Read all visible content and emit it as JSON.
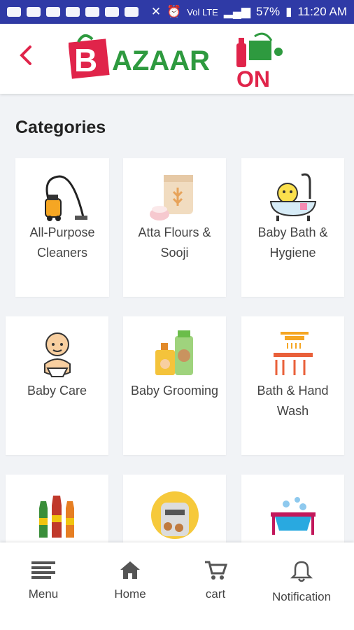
{
  "status_bar": {
    "battery": "57%",
    "time": "11:20 AM",
    "network_small": "Vol LTE"
  },
  "header": {
    "logo_text_main": "AZAAR",
    "logo_text_b": "B",
    "logo_text_on": "ON"
  },
  "page": {
    "section_title": "Categories"
  },
  "categories": [
    {
      "label_line1": "All-Purpose",
      "label_line2": "Cleaners",
      "icon": "vacuum-cleaner-icon"
    },
    {
      "label_line1": "Atta Flours &",
      "label_line2": "Sooji",
      "icon": "flour-bag-icon"
    },
    {
      "label_line1": "Baby Bath &",
      "label_line2": "Hygiene",
      "icon": "baby-bath-icon"
    },
    {
      "label_line1": "Baby Care",
      "label_line2": "",
      "icon": "baby-icon"
    },
    {
      "label_line1": "Baby Grooming",
      "label_line2": "",
      "icon": "baby-grooming-icon"
    },
    {
      "label_line1": "Bath & Hand",
      "label_line2": "Wash",
      "icon": "shower-icon"
    },
    {
      "label_line1": "",
      "label_line2": "",
      "icon": "bottles-icon"
    },
    {
      "label_line1": "",
      "label_line2": "",
      "icon": "cookie-jar-icon"
    },
    {
      "label_line1": "",
      "label_line2": "",
      "icon": "laundry-basin-icon"
    }
  ],
  "bottom_nav": [
    {
      "label": "Menu",
      "icon": "menu-icon"
    },
    {
      "label": "Home",
      "icon": "home-icon"
    },
    {
      "label": "cart",
      "icon": "cart-icon"
    },
    {
      "label": "Notification",
      "icon": "bell-icon"
    }
  ],
  "colors": {
    "status_bar": "#2f3aa6",
    "brand_red": "#e0244a",
    "brand_green": "#2e9a3f"
  }
}
